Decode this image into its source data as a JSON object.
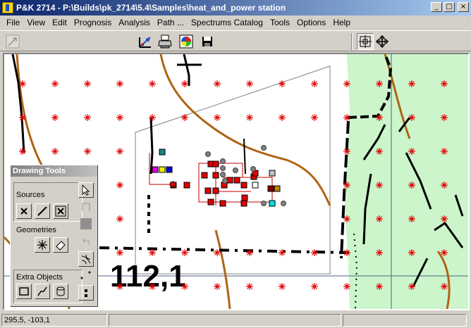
{
  "window": {
    "title": "P&K 2714 - P:\\Builds\\pk_2714\\5.4\\Samples\\heat_and_power station",
    "minimize_glyph": "_",
    "maximize_glyph": "□",
    "close_glyph": "×"
  },
  "menu": [
    "File",
    "View",
    "Edit",
    "Prognosis",
    "Analysis",
    "Path ...",
    "Spectrums Catalog",
    "Tools",
    "Options",
    "Help"
  ],
  "map": {
    "label": "112,1",
    "colors": {
      "receptor": "#e00000",
      "road": "#b06414",
      "green_area": "#ccf5cc",
      "source": "#e00000"
    }
  },
  "drawing_tools": {
    "title": "Drawing Tools",
    "sources_label": "Sources",
    "geometries_label": "Geometries",
    "extra_label": "Extra Objects"
  },
  "status": {
    "coordinates": "295,5, -103,1",
    "pane2": "",
    "pane3": ""
  }
}
